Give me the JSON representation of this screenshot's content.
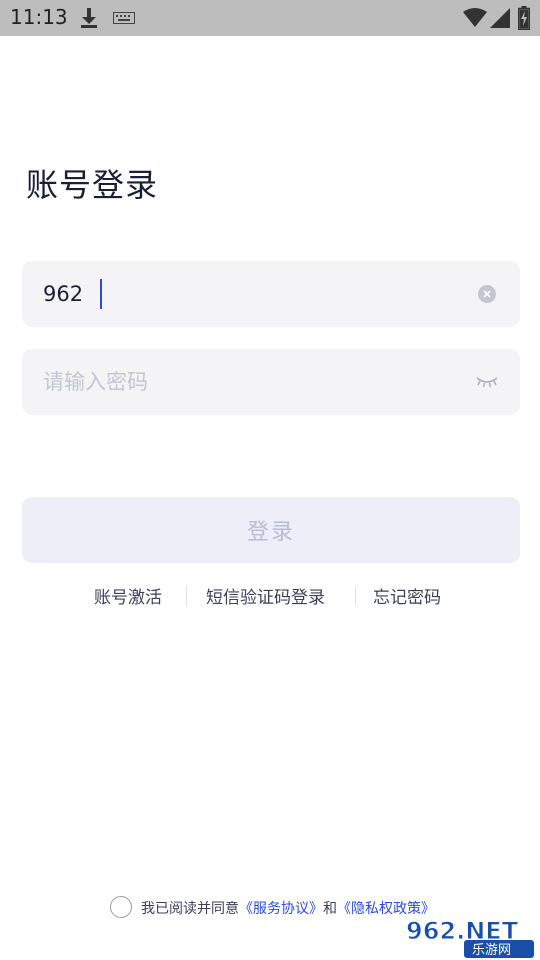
{
  "status_bar": {
    "time": "11:13",
    "icons": [
      "download-icon",
      "keyboard-icon",
      "wifi-icon",
      "signal-icon",
      "battery-icon"
    ]
  },
  "title": "账号登录",
  "account_field": {
    "value": "962",
    "icon": "clear-icon"
  },
  "password_field": {
    "value": "",
    "placeholder": "请输入密码",
    "icon": "eye-closed-icon"
  },
  "login_button": {
    "label": "登录"
  },
  "links": {
    "activate": "账号激活",
    "sms_login": "短信验证码登录",
    "forgot_password": "忘记密码"
  },
  "agreement": {
    "prefix": "我已阅读并同意",
    "service": "《服务协议》",
    "and": "和",
    "privacy": "《隐私权政策》"
  },
  "watermark": {
    "brand": "962.NET",
    "subtitle": "乐游网"
  },
  "colors": {
    "title": "#1a1f36",
    "accent": "#2d4bd8",
    "field_bg": "#f4f4f6",
    "button_disabled_bg": "#eeeef8",
    "button_disabled_text": "#b9bdd3",
    "status_bar_bg": "#bdbdbd"
  }
}
